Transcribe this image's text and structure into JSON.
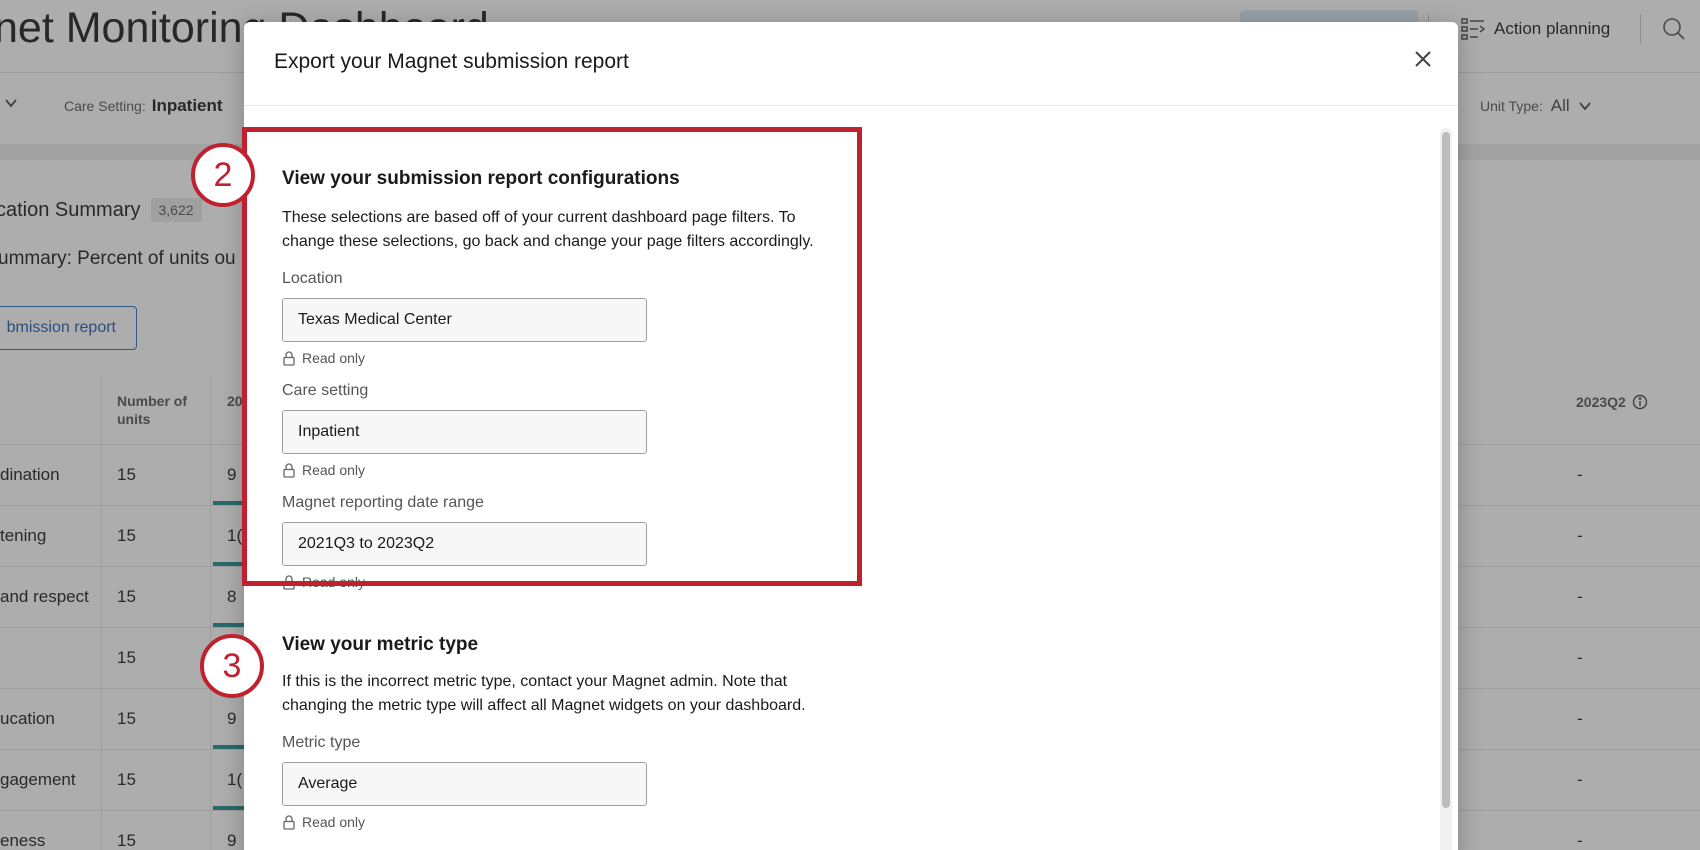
{
  "background": {
    "title": "net Monitoring Dashboard",
    "action_planning": "Action planning",
    "filters": {
      "care_setting_label": "Care Setting:",
      "care_setting_value": "Inpatient",
      "unit_type_label": "Unit Type:",
      "unit_type_value": "All"
    },
    "summary_title": "cation Summary",
    "summary_count": "3,622",
    "summary_subtitle": "ummary: Percent of units ou",
    "submission_button": "bmission report",
    "table": {
      "col_units": "Number of units",
      "col_2023q2": "2023Q2",
      "rows": [
        {
          "name": "dination",
          "units": "15",
          "val": "9",
          "q2": "-"
        },
        {
          "name": "tening",
          "units": "15",
          "val": "1(",
          "q2": "-"
        },
        {
          "name": "and respect",
          "units": "15",
          "val": "8",
          "q2": "-"
        },
        {
          "name": "",
          "units": "15",
          "val": "",
          "q2": "-"
        },
        {
          "name": "ucation",
          "units": "15",
          "val": "9",
          "q2": "-"
        },
        {
          "name": "gagement",
          "units": "15",
          "val": "1(",
          "q2": "-"
        },
        {
          "name": "eness",
          "units": "15",
          "val": "9",
          "q2": "-"
        }
      ]
    }
  },
  "modal": {
    "title": "Export your Magnet submission report",
    "config_section": {
      "title": "View your submission report configurations",
      "description": "These selections are based off of your current dashboard page filters. To change these selections, go back and change your page filters accordingly.",
      "fields": [
        {
          "label": "Location",
          "value": "Texas Medical Center",
          "note": "Read only"
        },
        {
          "label": "Care setting",
          "value": "Inpatient",
          "note": "Read only"
        },
        {
          "label": "Magnet reporting date range",
          "value": "2021Q3 to 2023Q2",
          "note": "Read only"
        }
      ]
    },
    "metric_section": {
      "title": "View your metric type",
      "description": "If this is the incorrect metric type, contact your Magnet admin. Note that changing the metric type will affect all Magnet widgets on your dashboard.",
      "field": {
        "label": "Metric type",
        "value": "Average",
        "note": "Read only"
      }
    }
  },
  "callouts": {
    "step_2": "2",
    "step_3": "3",
    "accent_color": "#c0212f"
  }
}
